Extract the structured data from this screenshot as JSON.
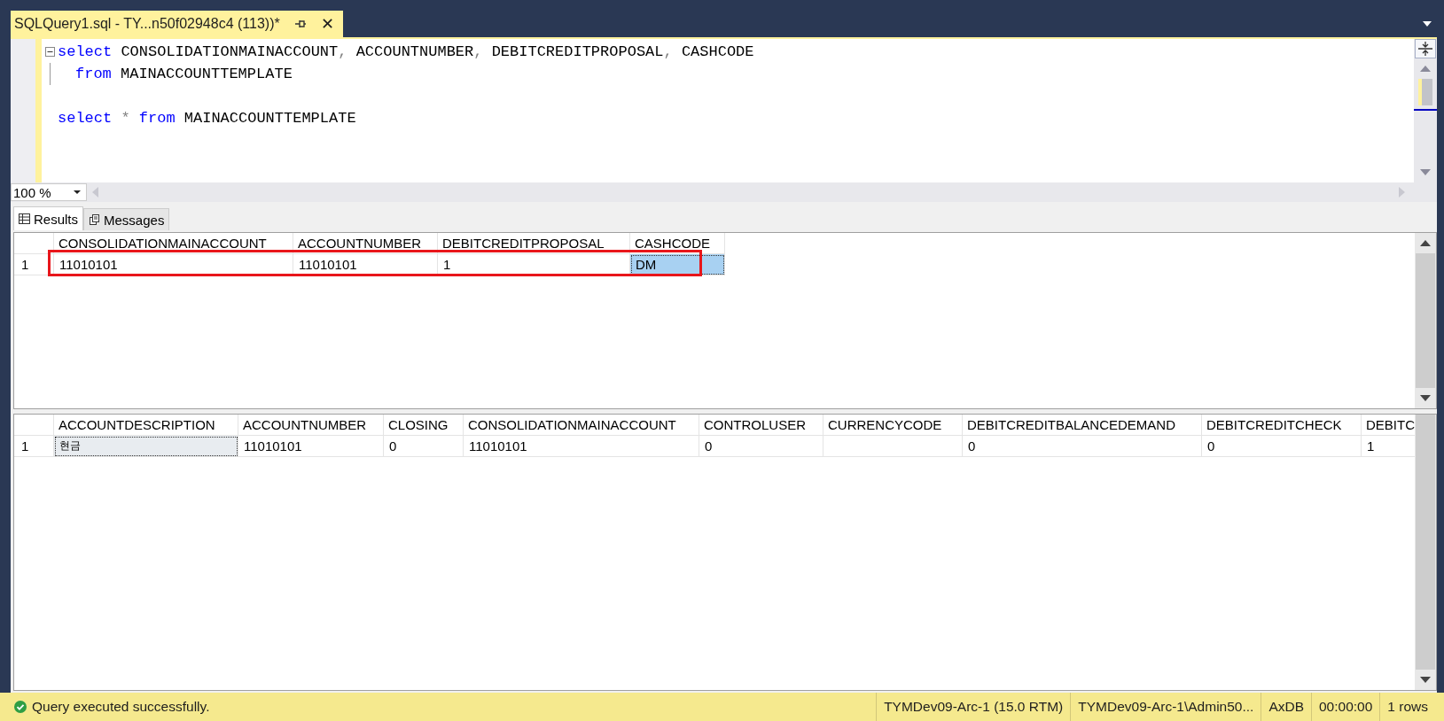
{
  "document_tab": {
    "title": "SQLQuery1.sql - TY...n50f02948c4 (113))*",
    "close": "✕"
  },
  "editor": {
    "lines": [
      {
        "kind": "code",
        "tokens": [
          {
            "text": "select",
            "kind": "keyword"
          },
          {
            "text": "CONSOLIDATIONMAINACCOUNT",
            "kind": "identifier"
          },
          {
            "text": ",",
            "kind": "punct"
          },
          {
            "text": "ACCOUNTNUMBER",
            "kind": "identifier"
          },
          {
            "text": ",",
            "kind": "punct"
          },
          {
            "text": "DEBITCREDITPROPOSAL",
            "kind": "identifier"
          },
          {
            "text": ",",
            "kind": "punct"
          },
          {
            "text": "CASHCODE",
            "kind": "identifier"
          }
        ],
        "expanded": true,
        "children": [
          {
            "kind": "code",
            "tokens": [
              {
                "text": "from",
                "kind": "keyword"
              },
              {
                "text": "MAINACCOUNTTEMPLATE",
                "kind": "identifier"
              }
            ]
          }
        ]
      },
      {
        "kind": "blank"
      },
      {
        "kind": "code",
        "tokens": [
          {
            "text": "select",
            "kind": "keyword"
          },
          {
            "text": "*",
            "kind": "punct"
          },
          {
            "text": "from",
            "kind": "keyword"
          },
          {
            "text": "MAINACCOUNTTEMPLATE",
            "kind": "identifier"
          }
        ]
      }
    ]
  },
  "zoom": "100 %",
  "result_tabs": [
    {
      "label": "Results",
      "selected": true
    },
    {
      "label": "Messages",
      "selected": false
    }
  ],
  "grids": [
    {
      "columns": [
        "CONSOLIDATIONMAINACCOUNT",
        "ACCOUNTNUMBER",
        "DEBITCREDITPROPOSAL",
        "CASHCODE"
      ],
      "rows": [
        {
          "number": "1",
          "cells": [
            {
              "text": "11010101",
              "selected": false
            },
            {
              "text": "11010101",
              "selected": false
            },
            {
              "text": "1",
              "selected": false
            },
            {
              "text": "DM",
              "selected": true
            }
          ]
        }
      ]
    },
    {
      "columns": [
        "ACCOUNTDESCRIPTION",
        "ACCOUNTNUMBER",
        "CLOSING",
        "CONSOLIDATIONMAINACCOUNT",
        "CONTROLUSER",
        "CURRENCYCODE",
        "DEBITCREDITBALANCEDEMAND",
        "DEBITCREDITCHECK",
        "DEBITC"
      ],
      "rows": [
        {
          "number": "1",
          "cells": [
            {
              "text": "현금",
              "selected": true
            },
            {
              "text": "11010101",
              "selected": false
            },
            {
              "text": "0",
              "selected": false
            },
            {
              "text": "11010101",
              "selected": false
            },
            {
              "text": "0",
              "selected": false
            },
            {
              "text": "",
              "selected": false
            },
            {
              "text": "0",
              "selected": false
            },
            {
              "text": "0",
              "selected": false
            },
            {
              "text": "1",
              "selected": false
            }
          ]
        }
      ]
    }
  ],
  "status_bar": {
    "message": "Query executed successfully.",
    "server": "TYMDev09-Arc-1 (15.0 RTM)",
    "user": "TYMDev09-Arc-1\\Admin50...",
    "database": "AxDB",
    "elapsed": "00:00:00",
    "rows": "1 rows"
  }
}
